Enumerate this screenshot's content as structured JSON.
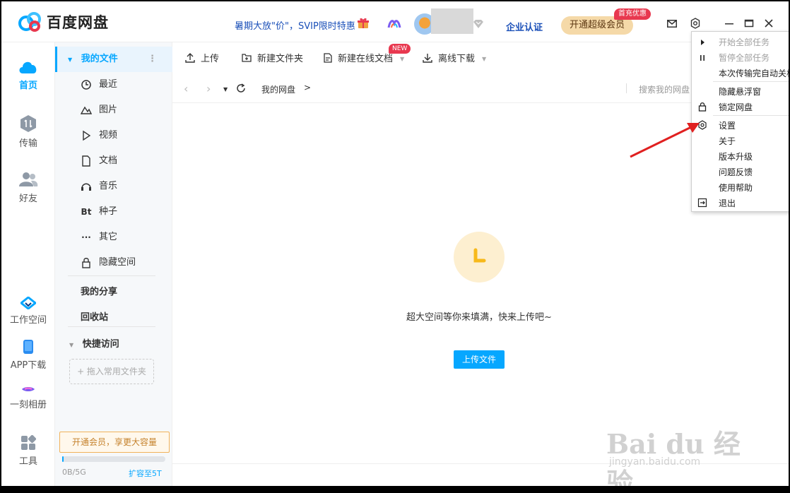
{
  "app": {
    "name": "百度网盘"
  },
  "header": {
    "promo": "暑期大放\"价\"，SVIP限时特惠",
    "enterprise": "企业认证",
    "svip_button": "开通超级会员",
    "svip_badge": "首充优惠"
  },
  "rail": {
    "items": [
      {
        "label": "首页",
        "icon": "cloud-icon"
      },
      {
        "label": "传输",
        "icon": "transfer-icon"
      },
      {
        "label": "好友",
        "icon": "friends-icon"
      },
      {
        "label": "工作空间",
        "icon": "workspace-icon"
      },
      {
        "label": "APP下载",
        "icon": "phone-icon"
      },
      {
        "label": "一刻相册",
        "icon": "album-icon"
      },
      {
        "label": "工具",
        "icon": "tools-icon"
      }
    ]
  },
  "sidebar": {
    "my_files": "我的文件",
    "items": [
      {
        "label": "最近",
        "icon": "clock-icon"
      },
      {
        "label": "图片",
        "icon": "image-icon"
      },
      {
        "label": "视频",
        "icon": "play-icon"
      },
      {
        "label": "文档",
        "icon": "document-icon"
      },
      {
        "label": "音乐",
        "icon": "headphones-icon"
      },
      {
        "label": "种子",
        "icon": "bt-icon",
        "glyph": "Bt"
      },
      {
        "label": "其它",
        "icon": "more-icon",
        "glyph": "···"
      },
      {
        "label": "隐藏空间",
        "icon": "lock-icon"
      }
    ],
    "my_share": "我的分享",
    "recycle": "回收站",
    "quick_access": "快捷访问",
    "drop_hint": "+ 拖入常用文件夹",
    "vip_promo": "开通会员，享更大容量",
    "storage_used": "0B/5G",
    "storage_fraction": 0.0,
    "expand": "扩容至5T"
  },
  "toolbar": {
    "upload": "上传",
    "new_folder": "新建文件夹",
    "new_online_doc": "新建在线文档",
    "new_badge": "NEW",
    "offline_download": "离线下载"
  },
  "path": {
    "root": "我的网盘",
    "separator": ">",
    "search_placeholder": "搜索我的网盘"
  },
  "empty_state": {
    "text": "超大空间等你来填满，快来上传吧~",
    "button": "上传文件"
  },
  "menu": {
    "start_all": "开始全部任务",
    "pause_all": "暂停全部任务",
    "auto_shutdown": "本次传输完自动关机",
    "hide_float": "隐藏悬浮窗",
    "lock": "锁定网盘",
    "settings": "设置",
    "about": "关于",
    "upgrade": "版本升级",
    "feedback": "问题反馈",
    "help": "使用帮助",
    "exit": "退出"
  },
  "watermark": {
    "main": "Bai du 经验",
    "sub": "jingyan.baidu.com"
  },
  "colors": {
    "accent": "#06a7ff",
    "promo_blue": "#1a4fb8",
    "badge_red": "#e8384f",
    "arrow_red": "#e02020"
  }
}
